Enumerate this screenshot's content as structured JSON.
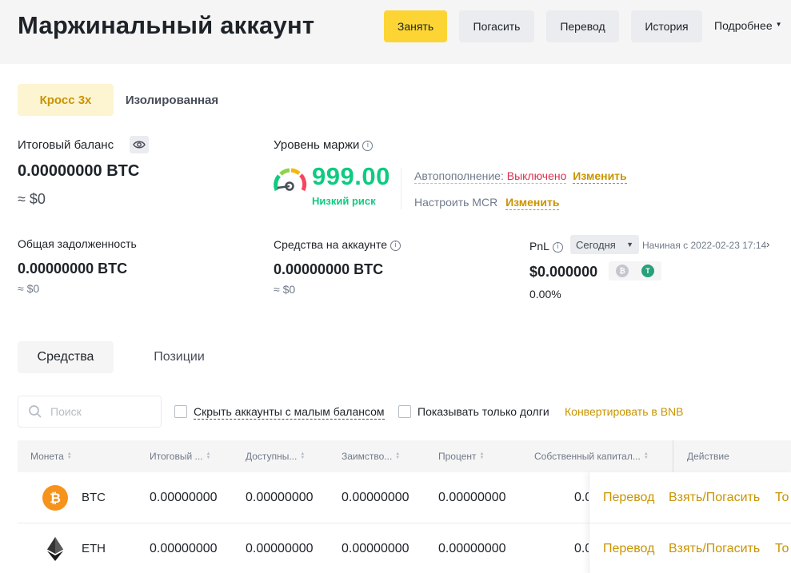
{
  "header": {
    "title": "Маржинальный аккаунт",
    "buttons": {
      "borrow": "Занять",
      "repay": "Погасить",
      "transfer": "Перевод",
      "history": "История"
    },
    "more": "Подробнее"
  },
  "mode_tabs": {
    "cross": "Кросс 3x",
    "isolated": "Изолированная"
  },
  "balance": {
    "label": "Итоговый баланс",
    "value": "0.00000000 BTC",
    "approx": "≈ $0"
  },
  "margin_level": {
    "label": "Уровень маржи",
    "value": "999.00",
    "risk": "Низкий риск",
    "auto_label": "Автопополнение:",
    "auto_status": "Выключено",
    "change": "Изменить",
    "mcr_label": "Настроить MCR",
    "mcr_change": "Изменить"
  },
  "debt": {
    "label": "Общая задолженность",
    "value": "0.00000000 BTC",
    "approx": "≈ $0"
  },
  "account_funds": {
    "label": "Средства на аккаунте",
    "value": "0.00000000 BTC",
    "approx": "≈ $0"
  },
  "pnl": {
    "label": "PnL",
    "period": "Сегодня",
    "since": "Начиная с 2022-02-23 17:14",
    "value": "$0.000000",
    "percent": "0.00%"
  },
  "asset_tabs": {
    "funds": "Средства",
    "positions": "Позиции"
  },
  "filters": {
    "search_placeholder": "Поиск",
    "hide_small": "Скрыть аккаунты с малым балансом",
    "only_debts": "Показывать только долги",
    "convert_bnb": "Конвертировать в BNB"
  },
  "table": {
    "headers": {
      "coin": "Монета",
      "total": "Итоговый ...",
      "available": "Доступны...",
      "borrowed": "Заимство...",
      "interest": "Процент",
      "equity": "Собственный капитал...",
      "action": "Действие"
    },
    "rows": [
      {
        "coin": "BTC",
        "total": "0.00000000",
        "available": "0.00000000",
        "borrowed": "0.00000000",
        "interest": "0.00000000",
        "equity": "0.0",
        "transfer": "Перевод",
        "borrow_repay": "Взять/Погасить",
        "trade": "То"
      },
      {
        "coin": "ETH",
        "total": "0.00000000",
        "available": "0.00000000",
        "borrowed": "0.00000000",
        "interest": "0.00000000",
        "equity": "0.0",
        "transfer": "Перевод",
        "borrow_repay": "Взять/Погасить",
        "trade": "То"
      }
    ]
  },
  "colors": {
    "accent": "#fcd535",
    "gold": "#c99400",
    "green": "#0ecb81",
    "red": "#d9304e",
    "btc": "#f7931a",
    "usdt": "#26a17b"
  },
  "icons": [
    "eye-icon",
    "info-icon",
    "gauge-icon",
    "search-icon",
    "btc-icon",
    "eth-icon",
    "usdt-icon",
    "chevron-right-icon",
    "sort-icon"
  ]
}
